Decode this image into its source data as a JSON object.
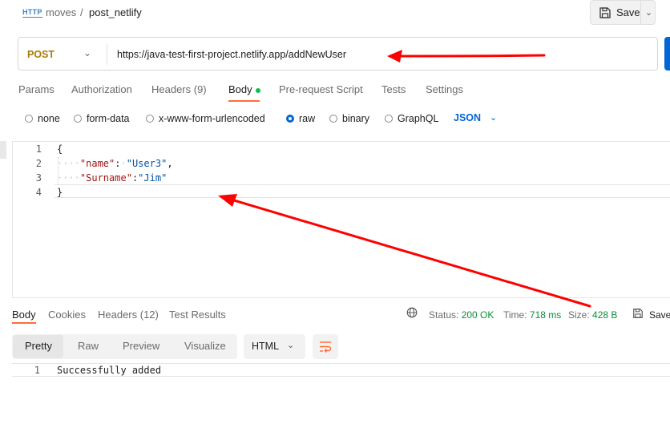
{
  "breadcrumb": {
    "http_icon": "HTTP",
    "collection": "moves",
    "separator": "/",
    "request_name": "post_netlify"
  },
  "save": {
    "label": "Save",
    "icon": "save-icon"
  },
  "request": {
    "method": "POST",
    "url": "https://java-test-first-project.netlify.app/addNewUser"
  },
  "tabs": [
    {
      "label": "Params"
    },
    {
      "label": "Authorization"
    },
    {
      "label": "Headers (9)"
    },
    {
      "label": "Body",
      "active": true
    },
    {
      "label": "Pre-request Script"
    },
    {
      "label": "Tests"
    },
    {
      "label": "Settings"
    }
  ],
  "body_types": [
    {
      "label": "none"
    },
    {
      "label": "form-data"
    },
    {
      "label": "x-www-form-urlencoded"
    },
    {
      "label": "raw",
      "selected": true
    },
    {
      "label": "binary"
    },
    {
      "label": "GraphQL"
    }
  ],
  "raw_format": "JSON",
  "editor": {
    "line_numbers": [
      "1",
      "2",
      "3",
      "4"
    ],
    "l1": "{",
    "l2_key": "\"name\"",
    "l2_colon": ":",
    "l2_val": "\"User3\"",
    "l2_comma": ",",
    "l3_key": "\"Surname\"",
    "l3_colon": ":",
    "l3_val": "\"Jim\"",
    "l4": "}"
  },
  "response": {
    "tabs": [
      {
        "label": "Body",
        "active": true
      },
      {
        "label": "Cookies"
      },
      {
        "label": "Headers (12)"
      },
      {
        "label": "Test Results"
      }
    ],
    "status_label": "Status:",
    "status_value": "200 OK",
    "time_label": "Time:",
    "time_value": "718 ms",
    "size_label": "Size:",
    "size_value": "428 B",
    "save_label": "Save",
    "views": [
      {
        "label": "Pretty",
        "active": true
      },
      {
        "label": "Raw"
      },
      {
        "label": "Preview"
      },
      {
        "label": "Visualize"
      }
    ],
    "format": "HTML",
    "line_number": "1",
    "body_text": "Successfully added"
  },
  "colors": {
    "accent_orange": "#ff6c37",
    "post_method": "#ad7a03",
    "link_blue": "#0265d2",
    "status_green": "#0b8e3a",
    "annotation_red": "#ff0000"
  }
}
